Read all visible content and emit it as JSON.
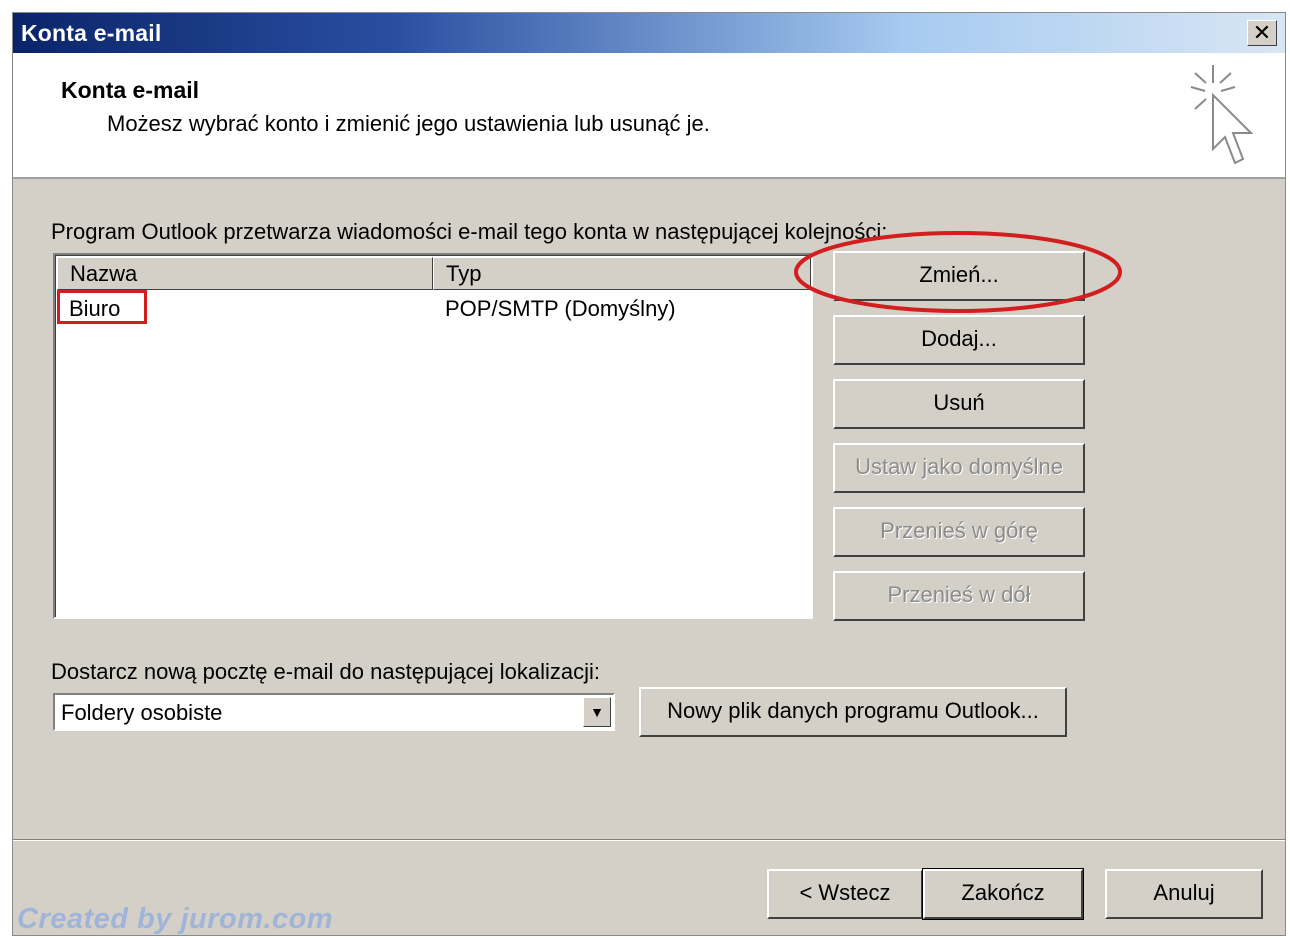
{
  "window": {
    "title": "Konta e-mail",
    "close_glyph": "✕"
  },
  "header": {
    "title": "Konta e-mail",
    "subtitle": "Możesz wybrać konto i zmienić jego ustawienia lub usunąć je.",
    "icon": "cursor-click-icon"
  },
  "accounts": {
    "label": "Program Outlook przetwarza wiadomości e-mail tego konta w następującej kolejności:",
    "columns": [
      "Nazwa",
      "Typ"
    ],
    "rows": [
      {
        "name": "Biuro",
        "type": "POP/SMTP (Domyślny)"
      }
    ]
  },
  "buttons": {
    "change": "Zmień...",
    "add": "Dodaj...",
    "remove": "Usuń",
    "set_default": "Ustaw jako domyślne",
    "move_up": "Przenieś w górę",
    "move_down": "Przenieś w dół"
  },
  "delivery": {
    "label": "Dostarcz nową pocztę e-mail do następującej lokalizacji:",
    "selected": "Foldery osobiste",
    "new_file_button": "Nowy plik danych programu Outlook..."
  },
  "footer": {
    "back": "< Wstecz",
    "finish": "Zakończ",
    "cancel": "Anuluj"
  },
  "watermark": "Created by jurom.com",
  "colors": {
    "annotation_red": "#d21e1e",
    "title_gradient_start": "#0a246a",
    "dialog_face": "#d4d0c8"
  }
}
